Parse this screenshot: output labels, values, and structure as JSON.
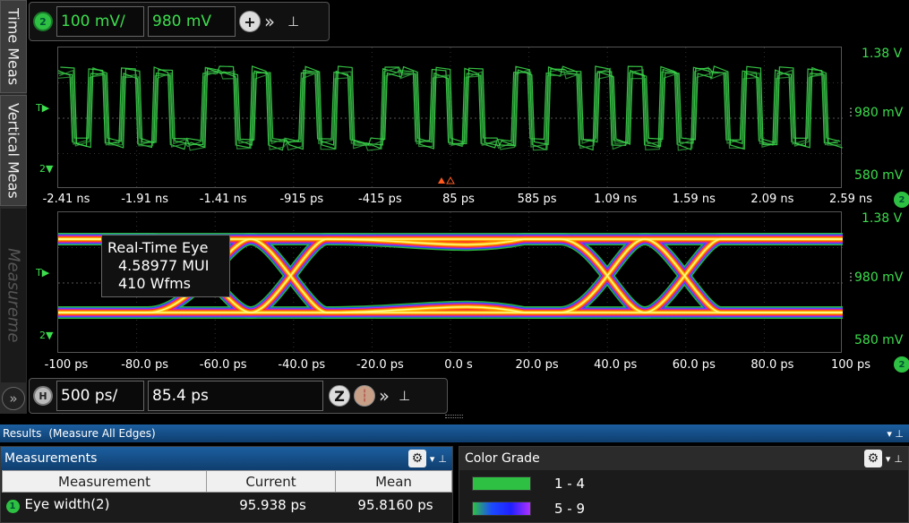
{
  "left_tabs": [
    "Time Meas",
    "Vertical Meas",
    "Measureme"
  ],
  "top_bar": {
    "channel": "2",
    "scale": "100 mV/",
    "offset": "980 mV"
  },
  "bottom_bar": {
    "channel": "H",
    "scale": "500 ps/",
    "position": "85.4 ps"
  },
  "top_plot": {
    "y_labels": [
      "1.38 V",
      "980 mV",
      "580 mV"
    ],
    "x_labels": [
      "-2.41 ns",
      "-1.91 ns",
      "-1.41 ns",
      "-915 ps",
      "-415 ps",
      "85 ps",
      "585 ps",
      "1.09 ns",
      "1.59 ns",
      "2.09 ns",
      "2.59 ns"
    ],
    "trigger_marker": "T",
    "channel_marker": "2",
    "end_badge": "2"
  },
  "bottom_plot": {
    "y_labels": [
      "1.38 V",
      "980 mV",
      "580 mV"
    ],
    "x_labels": [
      "-100 ps",
      "-80.0 ps",
      "-60.0 ps",
      "-40.0 ps",
      "-20.0 ps",
      "0.0 s",
      "20.0 ps",
      "40.0 ps",
      "60.0 ps",
      "80.0 ps",
      "100 ps"
    ],
    "trigger_marker": "T",
    "channel_marker": "2",
    "end_badge": "2",
    "eye_label": {
      "title": "Real-Time Eye",
      "line1": "4.58977 MUI",
      "line2": "410 Wfms"
    }
  },
  "results": {
    "title": "Results",
    "mode": "(Measure All Edges)",
    "measurements": {
      "title": "Measurements",
      "columns": [
        "Measurement",
        "Current",
        "Mean"
      ],
      "rows": [
        {
          "index": "1",
          "name": "Eye width(2)",
          "current": "95.938 ps",
          "mean": "95.8160 ps"
        }
      ]
    },
    "color_grade": {
      "title": "Color Grade",
      "rows": [
        {
          "range": "1 - 4"
        },
        {
          "range": "5 - 9"
        }
      ]
    }
  },
  "colors": {
    "trace": "#3dde4e",
    "accent": "#1c5fa0"
  }
}
